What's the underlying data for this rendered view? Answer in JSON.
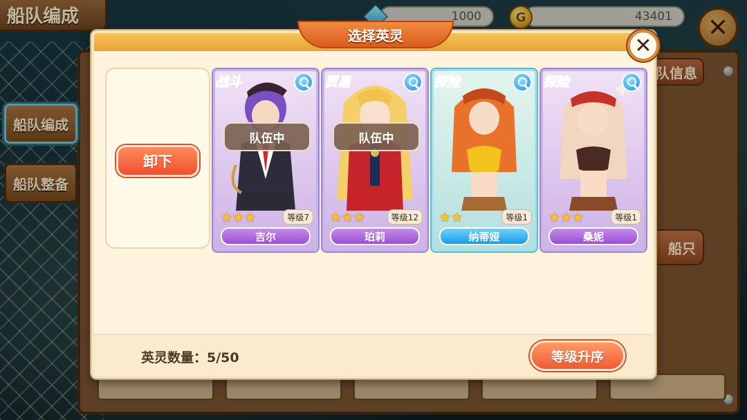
{
  "screen": {
    "title": "船队编成",
    "gems": "1000",
    "gold": "43401",
    "side_tabs": [
      "船队编成",
      "船队整备"
    ],
    "bg_info_button": "队信息",
    "bg_ship_button": "船只"
  },
  "modal": {
    "title": "选择英灵",
    "unload_button": "卸下",
    "count_label": "英灵数量：5/50",
    "sort_button": "等级升序",
    "heroes": [
      {
        "tag": "战斗",
        "name": "吉尔",
        "level": "等级7",
        "stars": "★★★",
        "in_team": "队伍中"
      },
      {
        "tag": "贸易",
        "name": "珀莉",
        "level": "等级12",
        "stars": "★★★",
        "in_team": "队伍中"
      },
      {
        "tag": "探险",
        "name": "纳蒂娅",
        "level": "等级1",
        "stars": "★★",
        "in_team": ""
      },
      {
        "tag": "探险",
        "name": "桑妮",
        "level": "等级1",
        "stars": "★★★",
        "in_team": ""
      }
    ]
  },
  "colors": {
    "modal_bg": "#fef4de",
    "accent_orange": "#f05a36",
    "name_purple": "#9b4fd3",
    "name_blue": "#1f9ae0",
    "star_gold": "#ffc12e"
  },
  "icons": [
    "gem-icon",
    "coin-icon",
    "close-icon",
    "zoom-icon",
    "star-icon"
  ]
}
